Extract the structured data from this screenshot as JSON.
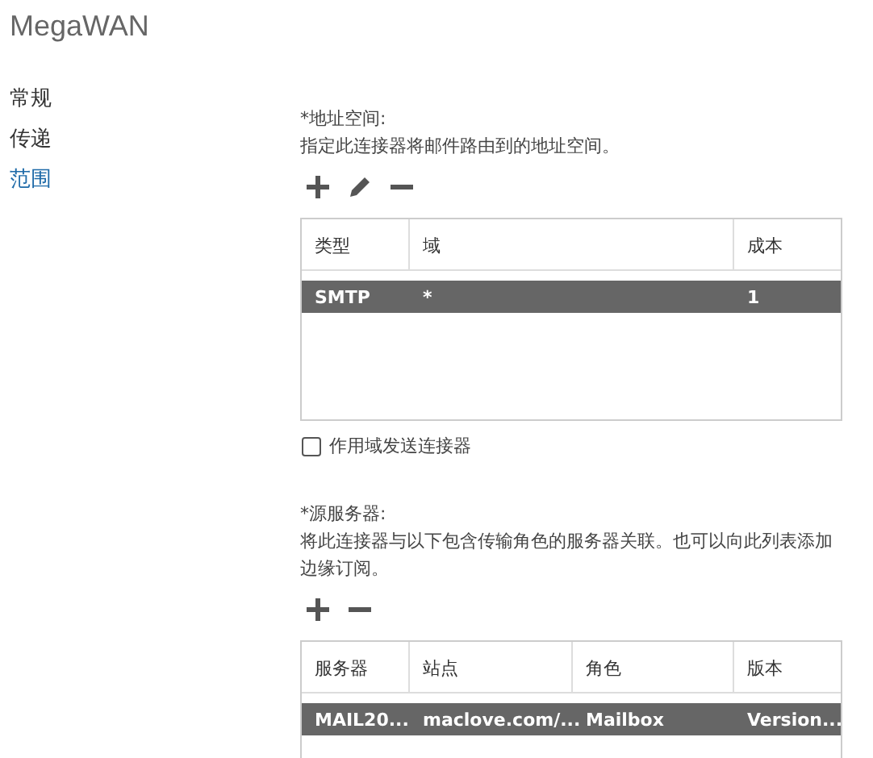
{
  "window": {
    "title": "MegaWAN"
  },
  "nav": [
    {
      "label": "常规",
      "selected": false
    },
    {
      "label": "传递",
      "selected": false
    },
    {
      "label": "范围",
      "selected": true
    }
  ],
  "address_space": {
    "label": "*地址空间:",
    "description": "指定此连接器将邮件路由到的地址空间。",
    "toolbar": [
      {
        "kind": "add"
      },
      {
        "kind": "edit"
      },
      {
        "kind": "remove"
      }
    ],
    "table": {
      "columns": [
        "类型",
        "域",
        "成本"
      ],
      "rows": [
        {
          "cells": [
            "SMTP",
            "*",
            "1"
          ],
          "selected": true
        }
      ]
    }
  },
  "scoped_send": {
    "label": "作用域发送连接器",
    "checked": false
  },
  "source_servers": {
    "label": "*源服务器:",
    "description": "将此连接器与以下包含传输角色的服务器关联。也可以向此列表添加边缘订阅。",
    "toolbar": [
      {
        "kind": "add"
      },
      {
        "kind": "remove"
      }
    ],
    "table": {
      "columns": [
        "服务器",
        "站点",
        "角色",
        "版本"
      ],
      "rows": [
        {
          "cells": [
            "MAIL20...",
            "maclove.com/...",
            "Mailbox",
            "Version..."
          ],
          "selected": true
        }
      ]
    }
  }
}
